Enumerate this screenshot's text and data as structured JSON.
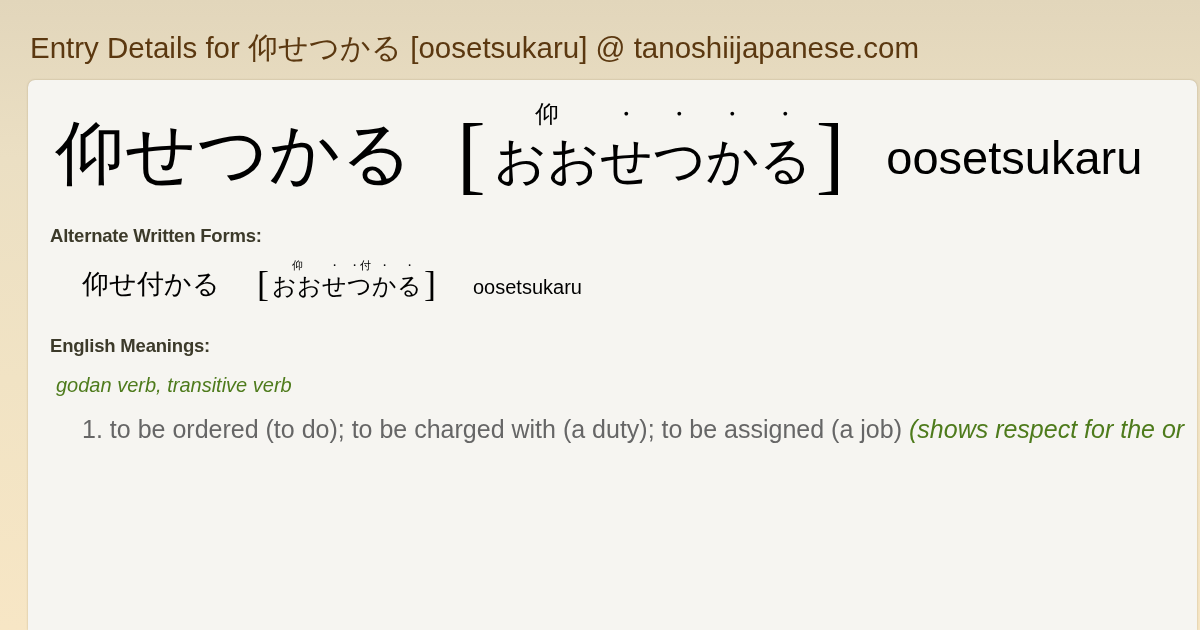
{
  "page": {
    "title": "Entry Details for 仰せつかる [oosetsukaru] @ tanoshiijapanese.com"
  },
  "entry": {
    "word": "仰せつかる",
    "open_bracket": "[",
    "reading": [
      {
        "kana": "おお",
        "furigana": "仰"
      },
      {
        "kana": "せ",
        "furigana": "・"
      },
      {
        "kana": "つ",
        "furigana": "・"
      },
      {
        "kana": "か",
        "furigana": "・"
      },
      {
        "kana": "る",
        "furigana": "・"
      }
    ],
    "close_bracket": "]",
    "romaji": "oosetsukaru"
  },
  "alternate_forms": {
    "heading": "Alternate Written Forms:",
    "forms": [
      {
        "word": "仰せ付かる",
        "open_bracket": "[",
        "reading": [
          {
            "kana": "おお",
            "furigana": "仰"
          },
          {
            "kana": "せ",
            "furigana": "・"
          },
          {
            "kana": "つ",
            "furigana": "・付"
          },
          {
            "kana": "か",
            "furigana": "・"
          },
          {
            "kana": "る",
            "furigana": "・"
          }
        ],
        "close_bracket": "]",
        "romaji": "oosetsukaru"
      }
    ]
  },
  "meanings": {
    "heading": "English Meanings:",
    "groups": [
      {
        "part_of_speech": "godan verb, transitive verb",
        "senses": [
          {
            "number": "1.",
            "text": "to be ordered (to do); to be charged with (a duty); to be assigned (a job)",
            "note": "(shows respect for the or"
          }
        ]
      }
    ]
  }
}
